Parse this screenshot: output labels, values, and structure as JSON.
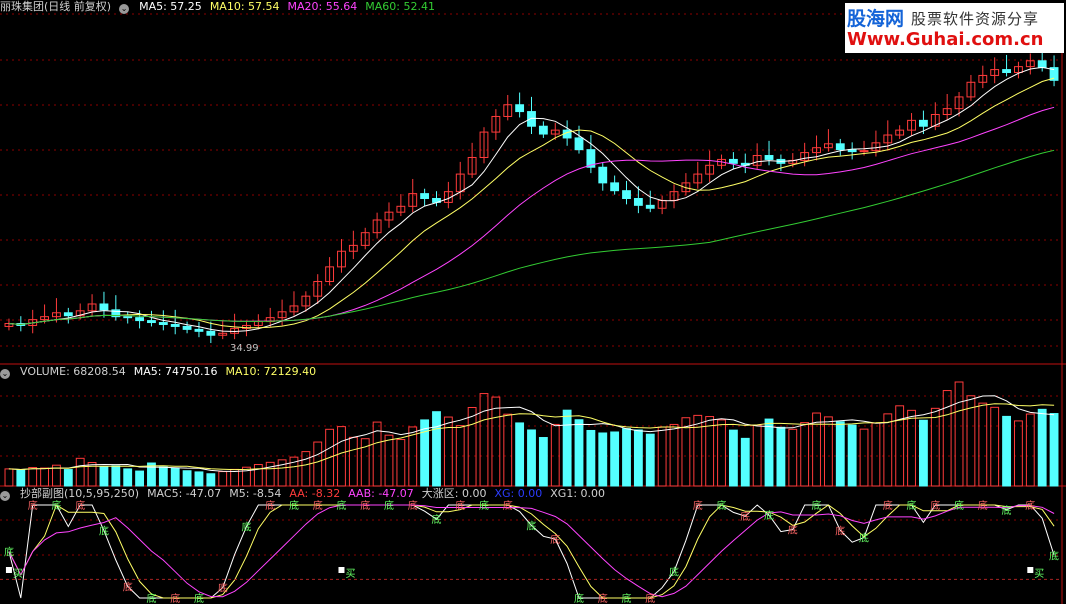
{
  "price_panel": {
    "title": "丽珠集团(日线 前复权)",
    "ma5": "MA5: 57.25",
    "ma10": "MA10: 57.54",
    "ma20": "MA20: 55.64",
    "ma60": "MA60: 52.41",
    "low_label": "34.99"
  },
  "volume_panel": {
    "volume": "VOLUME: 68208.54",
    "ma5": "MA5: 74750.16",
    "ma10": "MA10: 72129.40"
  },
  "indicator_panel": {
    "name": "抄部副图(10,5,95,250)",
    "mac5": "MAC5: -47.07",
    "m5": "M5: -8.54",
    "aa": "AA: -8.32",
    "aab": "AAB: -47.07",
    "dzq": "大涨区: 0.00",
    "xg": "XG: 0.00",
    "xg1": "XG1: 0.00",
    "signal_di": "底",
    "signal_mai": "买"
  },
  "watermark": {
    "brand": "股海网",
    "tagline": "股票软件资源分享",
    "url": "Www.Guhai.com.cn"
  },
  "colors": {
    "up": "#ff3b3b",
    "down": "#54ffff",
    "ma5": "#ffffff",
    "ma10": "#ffff66",
    "ma20": "#ff44ff",
    "ma60": "#33cc33",
    "grid": "#8b0000"
  },
  "chart_data": {
    "type": "candlestick",
    "price_reference": {
      "low": 34.99
    },
    "moving_averages": {
      "MA5": 57.25,
      "MA10": 57.54,
      "MA20": 55.64,
      "MA60": 52.41
    },
    "volume": {
      "last": 68208.54,
      "MA5": 74750.16,
      "MA10": 72129.4
    },
    "indicator": {
      "MAC5": -47.07,
      "M5": -8.54,
      "AA": -8.32,
      "AAB": -47.07,
      "大涨区": 0.0,
      "XG": 0.0,
      "XG1": 0.0
    },
    "closes": [
      36.2,
      36.0,
      36.6,
      36.9,
      37.3,
      37.0,
      37.5,
      38.2,
      37.6,
      36.9,
      36.8,
      36.5,
      36.3,
      36.1,
      35.9,
      35.6,
      35.4,
      35.0,
      35.2,
      35.7,
      36.0,
      36.4,
      36.8,
      37.4,
      38.0,
      39.0,
      40.5,
      42.0,
      43.6,
      44.2,
      45.5,
      46.8,
      47.6,
      48.2,
      49.5,
      49.0,
      48.6,
      49.7,
      51.5,
      53.2,
      55.8,
      57.4,
      58.6,
      57.9,
      56.4,
      55.6,
      56.0,
      55.2,
      54.0,
      52.2,
      50.6,
      49.8,
      49.0,
      48.3,
      48.0,
      48.8,
      49.7,
      50.6,
      51.5,
      52.4,
      53.0,
      52.6,
      52.4,
      53.4,
      53.0,
      52.6,
      52.9,
      53.7,
      54.2,
      54.6,
      54.0,
      53.8,
      53.9,
      54.7,
      55.5,
      56.0,
      57.0,
      56.4,
      57.6,
      58.2,
      59.4,
      60.9,
      61.6,
      62.2,
      61.9,
      62.5,
      63.1,
      62.4,
      61.1
    ],
    "volumes": [
      10.2,
      9.5,
      11.0,
      10.7,
      12.4,
      9.8,
      16.5,
      14.0,
      11.4,
      12.0,
      10.2,
      8.9,
      13.7,
      11.3,
      10.5,
      9.1,
      8.4,
      7.3,
      8.6,
      9.9,
      11.2,
      12.8,
      14.1,
      15.6,
      17.2,
      20.5,
      26.2,
      33.8,
      35.4,
      29.0,
      28.2,
      38.1,
      30.3,
      27.7,
      35.2,
      39.4,
      44.3,
      41.1,
      36.0,
      46.8,
      55.1,
      53.0,
      42.8,
      37.6,
      33.4,
      28.9,
      36.7,
      45.2,
      39.5,
      33.1,
      31.6,
      32.2,
      34.2,
      33.4,
      30.9,
      35.1,
      36.7,
      40.7,
      42.1,
      41.4,
      39.4,
      33.3,
      28.4,
      36.3,
      39.9,
      35.0,
      33.8,
      37.8,
      43.5,
      41.2,
      38.3,
      36.3,
      33.9,
      37.5,
      43.0,
      47.8,
      45.1,
      39.2,
      46.3,
      56.9,
      62.0,
      53.8,
      49.4,
      46.9,
      41.5,
      38.8,
      42.9,
      45.7,
      43.2
    ]
  }
}
